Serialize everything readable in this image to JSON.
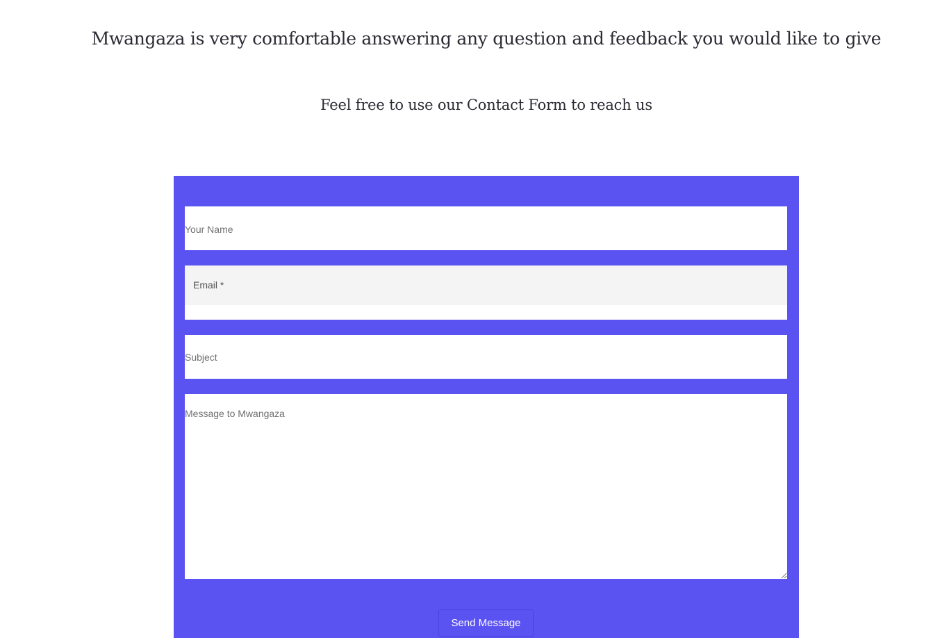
{
  "intro": {
    "headline": "Mwangaza is very comfortable answering any question and feedback you would like to give",
    "subline": "Feel free to use our Contact Form to reach us"
  },
  "form": {
    "name_placeholder": "Your Name",
    "email_placeholder": "Email *",
    "subject_placeholder": "Subject",
    "message_placeholder": "Message to Mwangaza",
    "send_label": "Send Message"
  },
  "colors": {
    "accent": "#5b52f2",
    "field_background": "#ffffff",
    "email_field_background": "#f4f4f4",
    "text": "#2b2b33"
  }
}
